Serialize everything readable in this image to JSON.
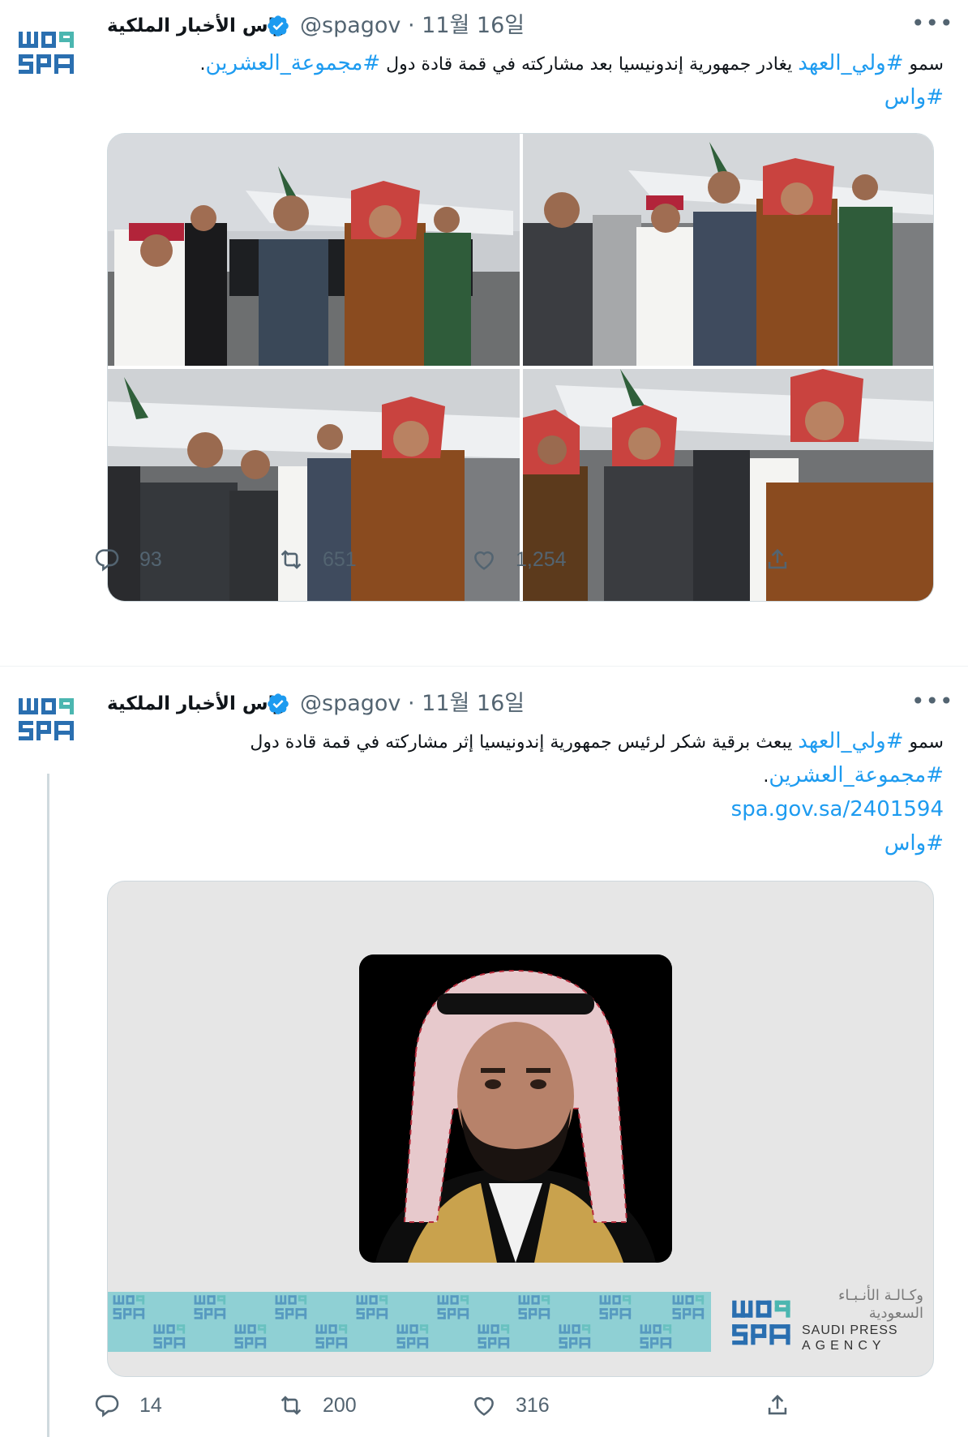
{
  "tweets": [
    {
      "author": {
        "display_name": "واس الأخبار الملكية",
        "handle": "@spagov",
        "date": "11월 16일",
        "verified": true
      },
      "text": {
        "line1_prefix": "سمو ",
        "line1_tag": "#ولي_العهد",
        "line1_mid": " يغادر جمهورية إندونيسيا بعد مشاركته في قمة قادة دول ",
        "line1_tag2": "#مجموعة_العشرين",
        "line1_end": ".",
        "line2_tag": "#واس"
      },
      "media_count": 4,
      "stats": {
        "replies": "93",
        "retweets": "651",
        "likes": "1,254"
      }
    },
    {
      "author": {
        "display_name": "واس الأخبار الملكية",
        "handle": "@spagov",
        "date": "11월 16일",
        "verified": true
      },
      "text": {
        "line1_prefix": "سمو ",
        "line1_tag": "#ولي_العهد",
        "line1_rest": " يبعث برقية شكر لرئيس جمهورية إندونيسيا إثر مشاركته في قمة قادة دول",
        "line2_tag": "#مجموعة_العشرين",
        "line2_end": ".",
        "link": "spa.gov.sa/2401594",
        "line4_tag": "#واس"
      },
      "card": {
        "brand_ar_line1": "وكـالـة الأنـبـاء",
        "brand_ar_line2": "السعودية",
        "brand_en_line1": "SAUDI PRESS",
        "brand_en_line2": "AGENCY"
      },
      "stats": {
        "replies": "14",
        "retweets": "200",
        "likes": "316"
      }
    }
  ],
  "icons": {
    "avatar": "spa-logo-avatar",
    "verified": "verified-badge-icon",
    "more": "more-icon",
    "reply": "reply-icon",
    "retweet": "retweet-icon",
    "like": "like-icon",
    "share": "share-icon"
  },
  "colors": {
    "link": "#1d9bf0",
    "muted": "#536471",
    "spa_blue": "#2a6fb0",
    "banner": "#8fd0d4"
  }
}
